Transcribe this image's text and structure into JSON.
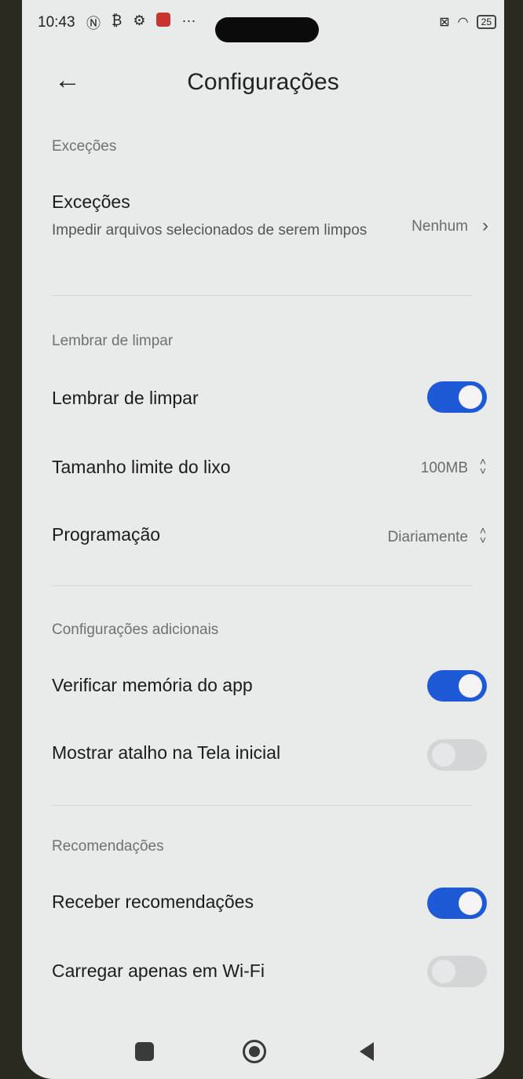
{
  "status_bar": {
    "time": "10:43",
    "battery": "25"
  },
  "header": {
    "title": "Configurações"
  },
  "sections": {
    "excecoes": {
      "label": "Exceções",
      "item": {
        "title": "Exceções",
        "subtitle": "Impedir arquivos selecionados de serem limpos",
        "value": "Nenhum"
      }
    },
    "lembrar": {
      "label": "Lembrar de limpar",
      "toggle_item": {
        "title": "Lembrar de limpar",
        "on": true
      },
      "size_limit": {
        "title": "Tamanho limite do lixo",
        "value": "100MB"
      },
      "schedule": {
        "title": "Programação",
        "value": "Diariamente"
      }
    },
    "adicionais": {
      "label": "Configurações adicionais",
      "check_memory": {
        "title": "Verificar memória do app",
        "on": true
      },
      "shortcut": {
        "title": "Mostrar atalho na Tela inicial",
        "on": false
      }
    },
    "recomendacoes": {
      "label": "Recomendações",
      "receive": {
        "title": "Receber recomendações",
        "on": true
      },
      "wifi_only": {
        "title": "Carregar apenas em Wi-Fi",
        "on": false
      }
    }
  },
  "icons": {
    "back": "arrow-left-icon",
    "chevron": "chevron-right-icon",
    "updown": "up-down-chevron-icon"
  },
  "colors": {
    "toggle_on": "#1e5ad6",
    "toggle_off": "#d3d5d6",
    "background": "#e9eaea"
  }
}
